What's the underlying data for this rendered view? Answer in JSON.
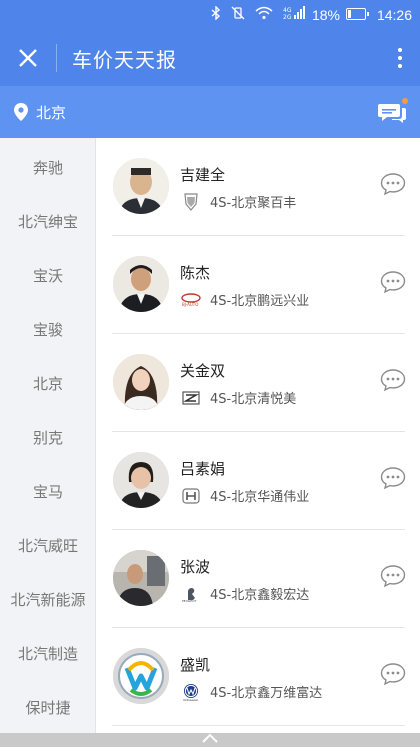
{
  "status_bar": {
    "battery_percent": "18%",
    "time": "14:26"
  },
  "app_bar": {
    "title": "车价天天报"
  },
  "location_bar": {
    "city": "北京"
  },
  "sidebar": {
    "brands": [
      "奔驰",
      "北汽绅宝",
      "宝沃",
      "宝骏",
      "北京",
      "别克",
      "宝马",
      "北汽威旺",
      "北汽新能源",
      "北汽制造",
      "保时捷"
    ]
  },
  "sales_list": [
    {
      "name": "吉建全",
      "dealer": "4S-北京聚百丰",
      "brand_icon": "cadillac-logo-icon"
    },
    {
      "name": "陈杰",
      "dealer": "4S-北京鹏远兴业",
      "brand_icon": "beiqi-logo-icon"
    },
    {
      "name": "关金双",
      "dealer": "4S-北京清悦美",
      "brand_icon": "zotye-logo-icon"
    },
    {
      "name": "吕素娟",
      "dealer": "4S-北京华通伟业",
      "brand_icon": "honda-logo-icon"
    },
    {
      "name": "张波",
      "dealer": "4S-北京鑫毅宏达",
      "brand_icon": "peugeot-logo-icon"
    },
    {
      "name": "盛凯",
      "dealer": "4S-北京鑫万维富达",
      "brand_icon": "volkswagen-logo-icon"
    }
  ],
  "colors": {
    "primary": "#4f85ea",
    "location_bar": "#5f93f1",
    "sidebar_bg": "#f2f3f6",
    "notification_dot": "#ff9a3a"
  }
}
